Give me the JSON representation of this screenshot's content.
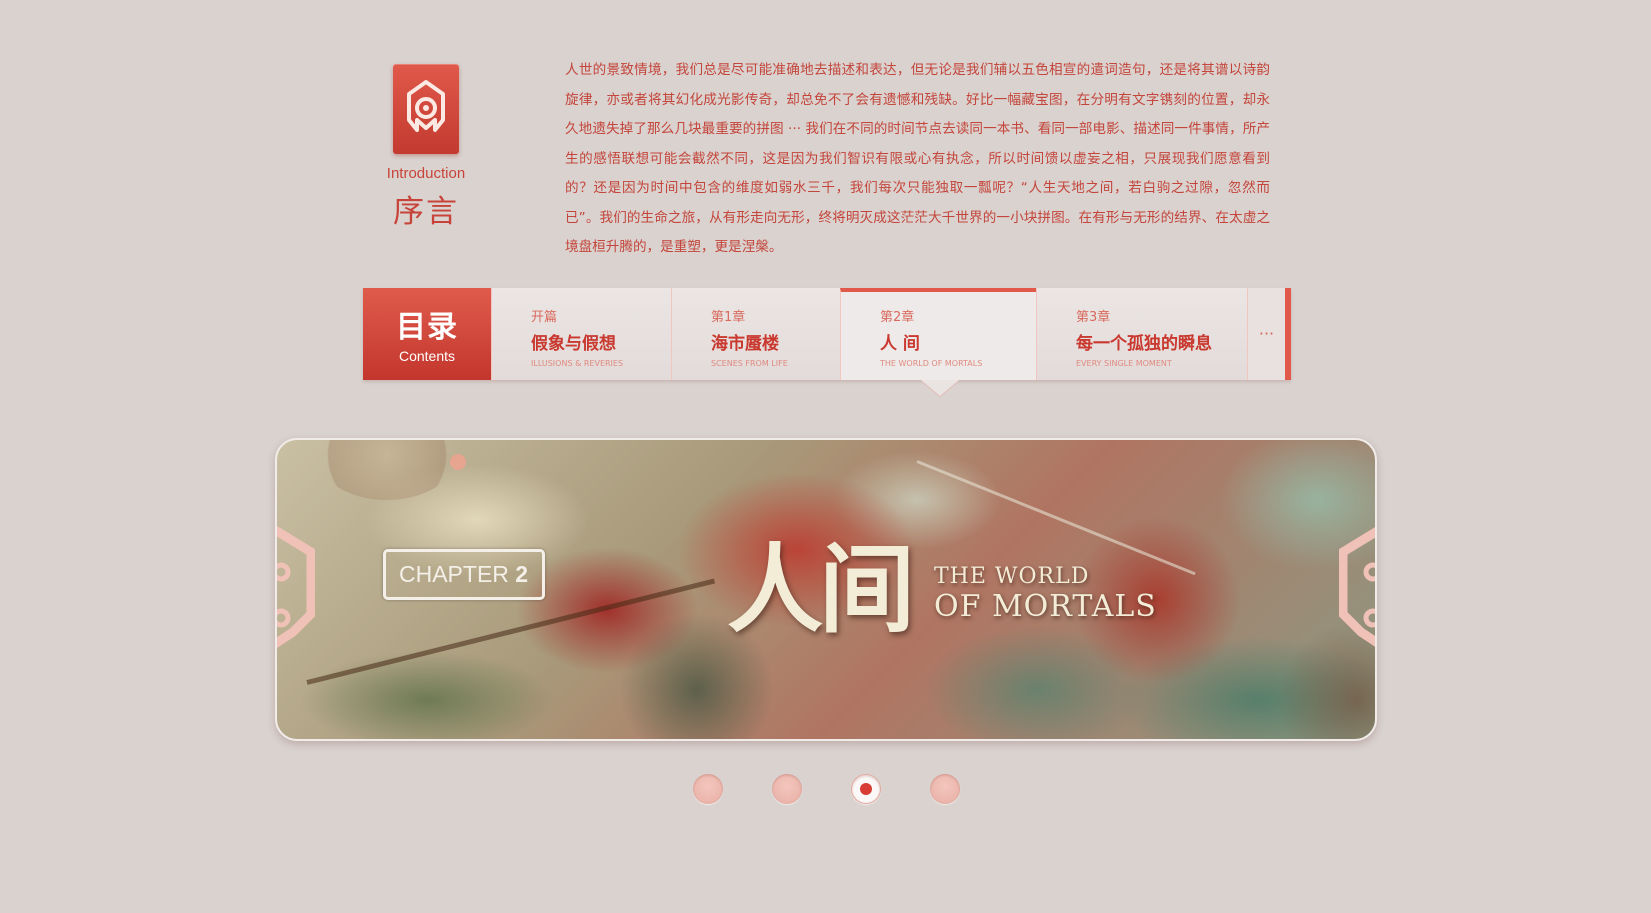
{
  "intro": {
    "logo_icon": "intro-emblem-icon",
    "label_en": "Introduction",
    "label_cn": "序言",
    "paragraph": "人世的景致情境，我们总是尽可能准确地去描述和表达，但无论是我们辅以五色相宣的遣词造句，还是将其谱以诗韵旋律，亦或者将其幻化成光影传奇，却总免不了会有遗憾和残缺。好比一幅藏宝图，在分明有文字镌刻的位置，却永久地遗失掉了那么几块最重要的拼图 ··· 我们在不同的时间节点去读同一本书、看同一部电影、描述同一件事情，所产生的感悟联想可能会截然不同，这是因为我们智识有限或心有执念，所以时间馈以虚妄之相，只展现我们愿意看到的？还是因为时间中包含的维度如弱水三千，我们每次只能独取一瓢呢？“人生天地之间，若白驹之过隙，忽然而已”。我们的生命之旅，从有形走向无形，终将明灭成这茫茫大千世界的一小块拼图。在有形与无形的结界、在太虚之境盘桓升腾的，是重塑，更是涅槃。"
  },
  "contents": {
    "label_cn": "目录",
    "label_en": "Contents",
    "more_label": "···",
    "chapters": [
      {
        "num": "开篇",
        "title": "假象与假想",
        "en": "ILLUSIONS & REVERIES",
        "active": false
      },
      {
        "num": "第1章",
        "title": "海市蜃楼",
        "en": "SCENES FROM LIFE",
        "active": false
      },
      {
        "num": "第2章",
        "title": "人 间",
        "en": "THE WORLD OF MORTALS",
        "active": true
      },
      {
        "num": "第3章",
        "title": "每一个孤独的瞬息",
        "en": "EVERY SINGLE MOMENT",
        "active": false
      }
    ]
  },
  "banner": {
    "chapter_prefix": "CHAPTER ",
    "chapter_number": "2",
    "title_cn": "人间",
    "title_en_line1": "THE WORLD",
    "title_en_line2": "OF MORTALS",
    "ornament_icon": "scroll-ornament-icon"
  },
  "pager": {
    "count": 4,
    "active_index": 2
  },
  "colors": {
    "background": "#d9d2cf",
    "accent": "#e0594a",
    "accent_dark": "#c3362d",
    "text_red": "#c4453b",
    "dot_inactive": "#efbcb3",
    "dot_active": "#d73d34"
  }
}
